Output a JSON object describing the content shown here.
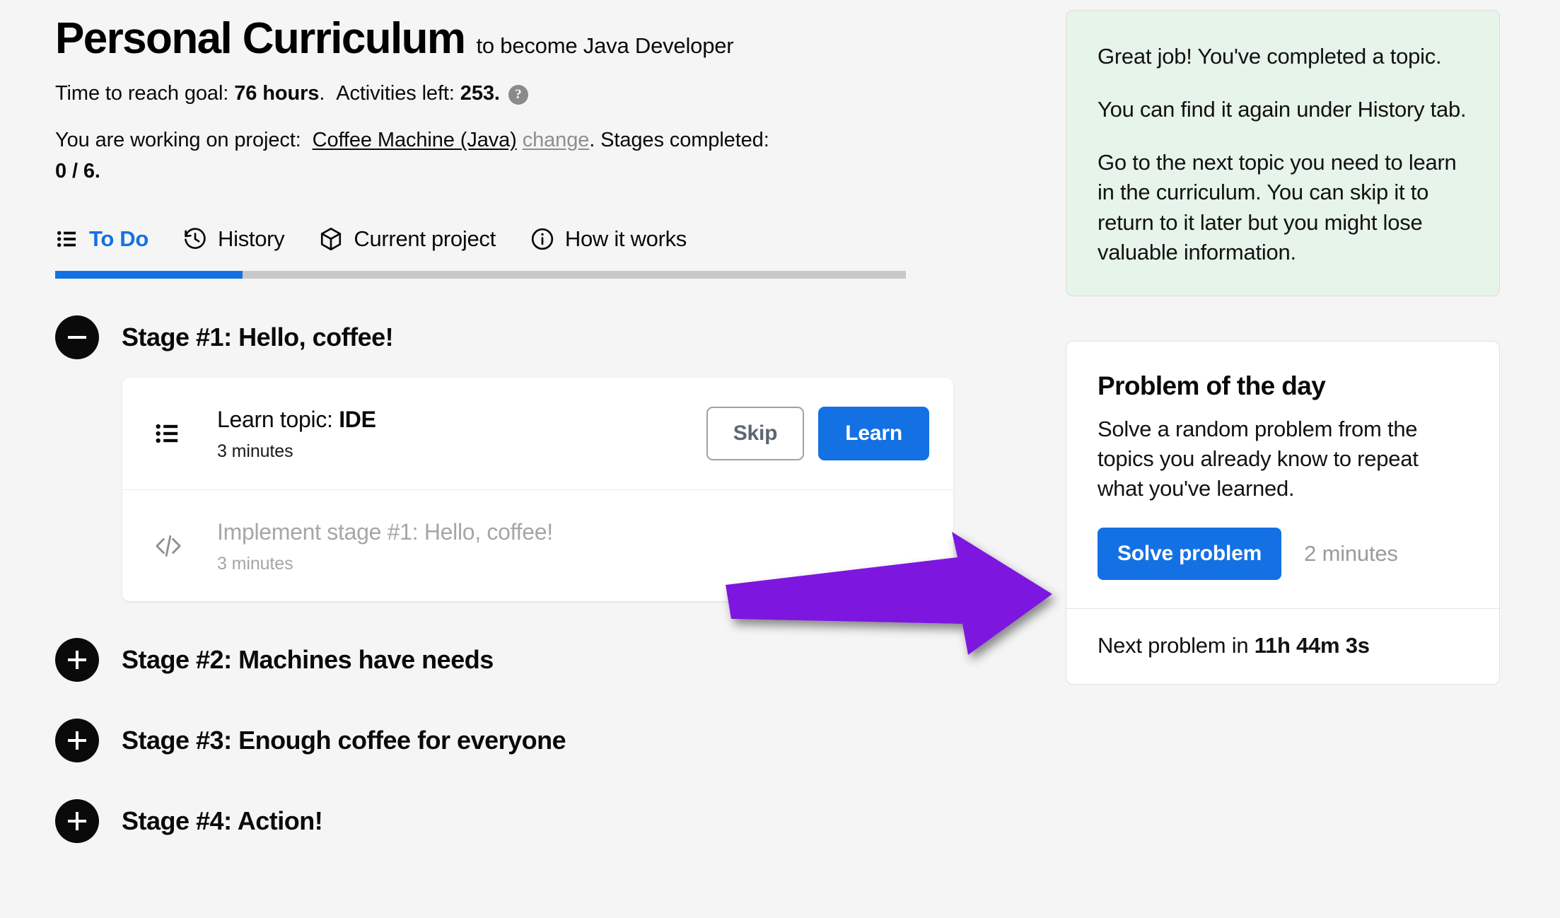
{
  "header": {
    "title": "Personal Curriculum",
    "subtitle": "to become Java Developer",
    "time_label": "Time to reach goal:",
    "time_value": "76 hours",
    "time_period": ".",
    "activities_label": "Activities left:",
    "activities_value": "253",
    "activities_period": ".",
    "help_icon_glyph": "?",
    "project_prefix": "You are working on project:",
    "project_name": "Coffee Machine (Java)",
    "project_change_link": "change",
    "project_suffix": ". Stages completed:",
    "stages_completed": "0 / 6."
  },
  "tabs": [
    {
      "label": "To Do",
      "icon": "list-icon",
      "active": true
    },
    {
      "label": "History",
      "icon": "history-clock-icon",
      "active": false
    },
    {
      "label": "Current project",
      "icon": "cube-icon",
      "active": false
    },
    {
      "label": "How it works",
      "icon": "info-circle-icon",
      "active": false
    }
  ],
  "progress": {
    "percent": 22,
    "fill_color": "#1471e3",
    "track_color": "#c8c8c8"
  },
  "stages": [
    {
      "title": "Stage #1: Hello, coffee!",
      "expanded": true,
      "toggle_state": "minus",
      "activities": [
        {
          "icon": "list-icon",
          "title_prefix": "Learn topic: ",
          "title_bold": "IDE",
          "duration": "3 minutes",
          "dim": false,
          "skip_label": "Skip",
          "learn_label": "Learn"
        },
        {
          "icon": "code-icon",
          "title_prefix": "Implement stage #1: Hello, coffee!",
          "title_bold": "",
          "duration": "3 minutes",
          "dim": true,
          "skip_label": "",
          "learn_label": ""
        }
      ]
    },
    {
      "title": "Stage #2: Machines have needs",
      "expanded": false,
      "toggle_state": "plus",
      "activities": []
    },
    {
      "title": "Stage #3: Enough coffee for everyone",
      "expanded": false,
      "toggle_state": "plus",
      "activities": []
    },
    {
      "title": "Stage #4: Action!",
      "expanded": false,
      "toggle_state": "plus",
      "activities": []
    }
  ],
  "tip_card": {
    "background_color": "#e6f4ea",
    "paragraphs": [
      "Great job! You've completed a topic.",
      "You can find it again under History tab.",
      "Go to the next topic you need to learn in the curriculum. You can skip it to return to it later but you might lose valuable information."
    ]
  },
  "problem_card": {
    "title": "Problem of the day",
    "description": "Solve a random problem from the topics you already know to repeat what you've learned.",
    "solve_button": "Solve problem",
    "duration": "2 minutes",
    "footer_prefix": "Next problem in ",
    "footer_time": "11h 44m 3s"
  },
  "annotation": {
    "type": "arrow",
    "color": "#7d17df",
    "direction": "right",
    "points_to": "problem-of-the-day-card"
  },
  "colors": {
    "accent_blue": "#1471e3",
    "page_background": "#f5f5f5",
    "text_primary": "#0a0a0a",
    "text_muted": "#a6a6a6",
    "arrow_purple": "#7d17df",
    "tip_green": "#e6f4ea"
  }
}
